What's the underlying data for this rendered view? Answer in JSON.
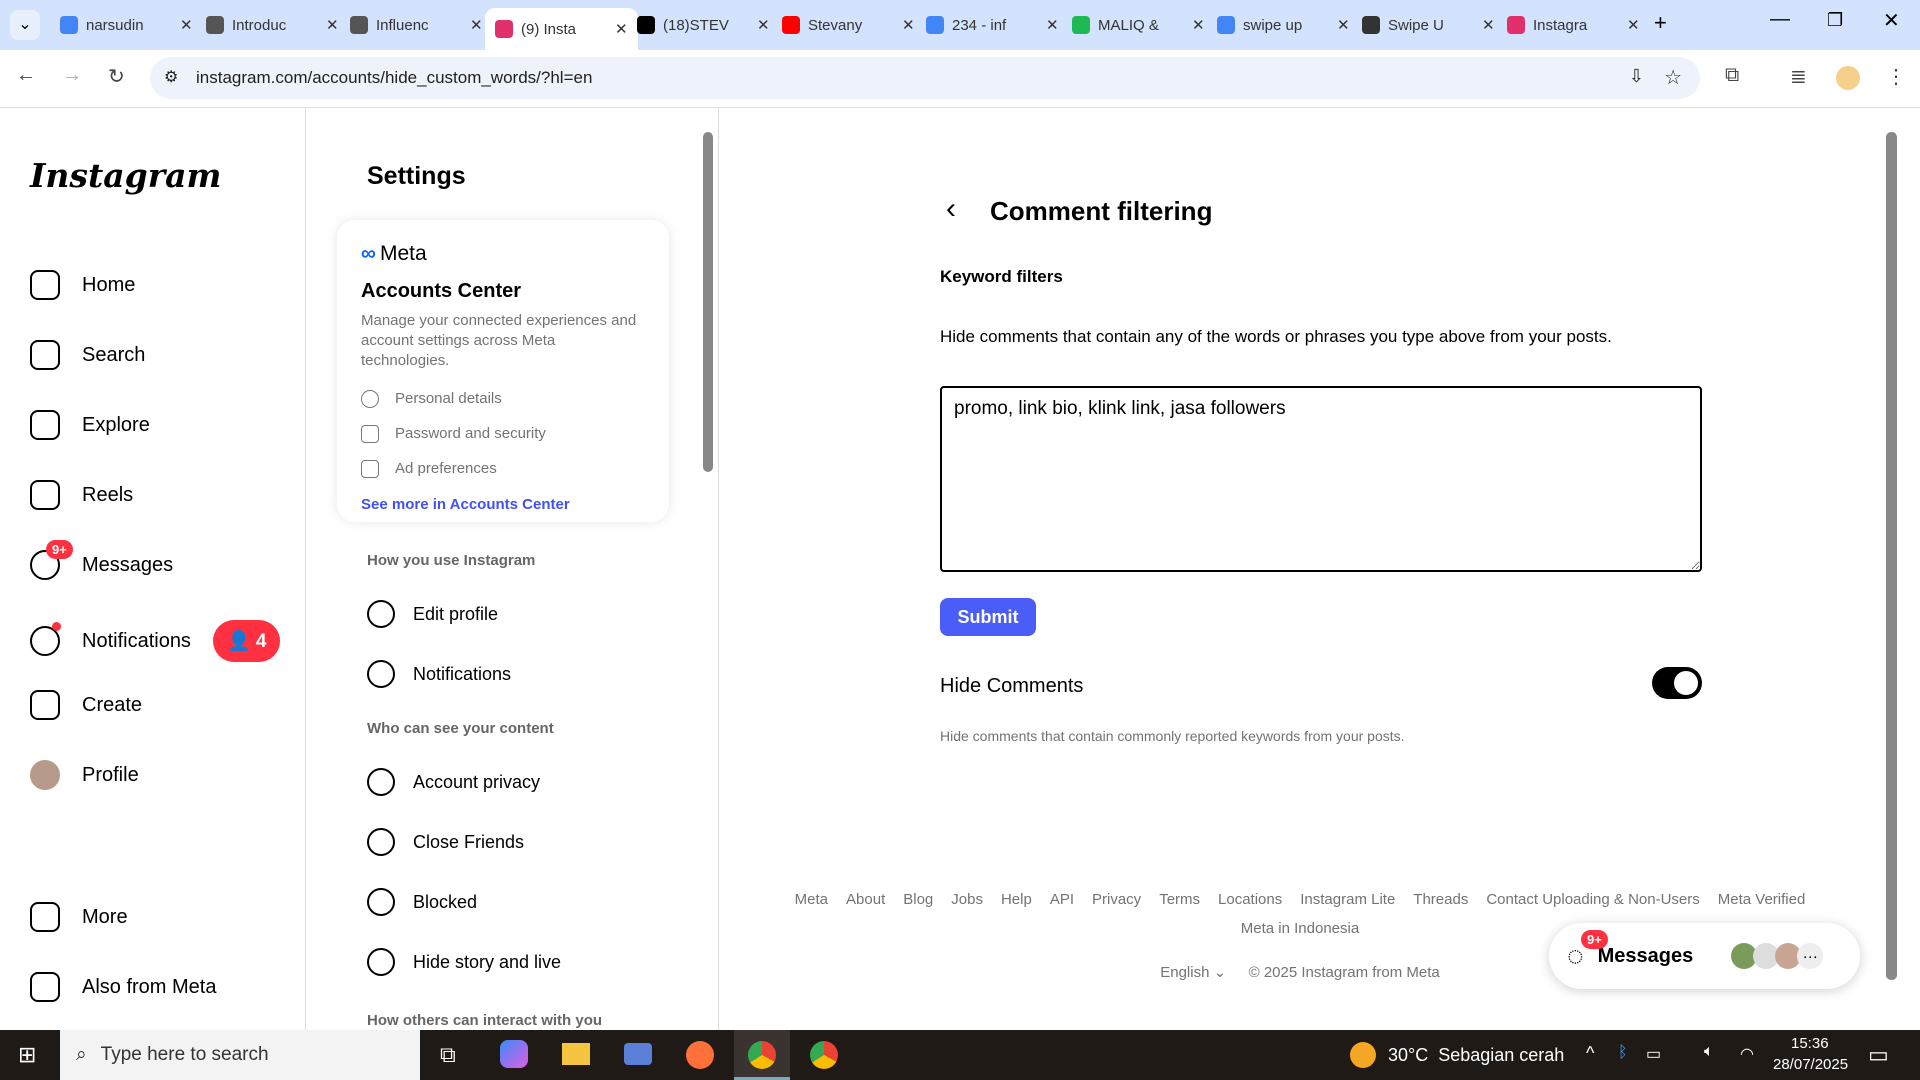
{
  "browser": {
    "tabs": [
      {
        "title": "narsudin",
        "color": "#4285f4"
      },
      {
        "title": "Introduc",
        "color": "#555"
      },
      {
        "title": "Influenc",
        "color": "#555"
      },
      {
        "title": "(9) Insta",
        "color": "#e1306c",
        "active": true
      },
      {
        "title": "(18)STEV",
        "color": "#000"
      },
      {
        "title": "Stevany",
        "color": "#ff0000"
      },
      {
        "title": "234 - inf",
        "color": "#4285f4"
      },
      {
        "title": "MALIQ &",
        "color": "#1db954"
      },
      {
        "title": "swipe up",
        "color": "#4285f4"
      },
      {
        "title": "Swipe U",
        "color": "#333"
      },
      {
        "title": "Instagra",
        "color": "#e1306c"
      }
    ],
    "url": "instagram.com/accounts/hide_custom_words/?hl=en"
  },
  "nav": {
    "logo": "Instagram",
    "items": [
      {
        "label": "Home"
      },
      {
        "label": "Search"
      },
      {
        "label": "Explore"
      },
      {
        "label": "Reels"
      },
      {
        "label": "Messages",
        "badge": "9+"
      },
      {
        "label": "Notifications",
        "count": "4"
      },
      {
        "label": "Create"
      },
      {
        "label": "Profile"
      },
      {
        "label": "More"
      },
      {
        "label": "Also from Meta"
      }
    ]
  },
  "settings": {
    "title": "Settings",
    "card": {
      "brand": "Meta",
      "title": "Accounts Center",
      "desc": "Manage your connected experiences and account settings across Meta technologies.",
      "items": [
        "Personal details",
        "Password and security",
        "Ad preferences"
      ],
      "link": "See more in Accounts Center"
    },
    "section1": "How you use Instagram",
    "items1": [
      "Edit profile",
      "Notifications"
    ],
    "section2": "Who can see your content",
    "items2": [
      "Account privacy",
      "Close Friends",
      "Blocked",
      "Hide story and live"
    ],
    "section3": "How others can interact with you"
  },
  "main": {
    "title": "Comment filtering",
    "keyword_label": "Keyword filters",
    "keyword_desc": "Hide comments that contain any of the words or phrases you type above from your posts.",
    "keywords": "promo, link bio, klink link, jasa followers",
    "submit": "Submit",
    "hide_label": "Hide Comments",
    "hide_on": true,
    "hide_desc": "Hide comments that contain commonly reported keywords from your posts."
  },
  "footer": {
    "links": [
      "Meta",
      "About",
      "Blog",
      "Jobs",
      "Help",
      "API",
      "Privacy",
      "Terms",
      "Locations",
      "Instagram Lite",
      "Threads",
      "Contact Uploading & Non-Users",
      "Meta Verified"
    ],
    "links2": "Meta in Indonesia",
    "language": "English",
    "copyright": "© 2025 Instagram from Meta"
  },
  "messages_pill": {
    "label": "Messages",
    "badge": "9+"
  },
  "taskbar": {
    "search": "Type here to search",
    "weather": "30°C  Sebagian cerah",
    "time": "15:36",
    "date": "28/07/2025"
  }
}
